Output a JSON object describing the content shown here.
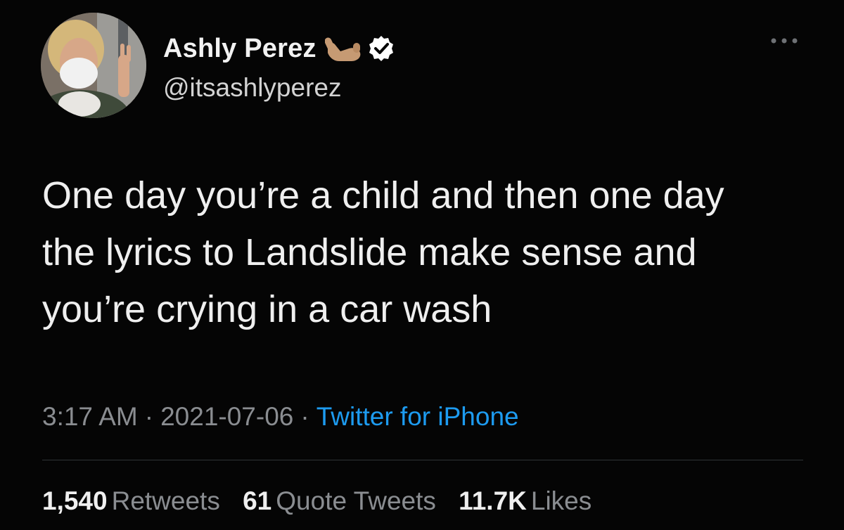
{
  "author": {
    "display_name": "Ashly Perez",
    "handle": "@itsashlyperez",
    "emoji_icon": "call-me-hand-emoji",
    "verified_icon": "verified-badge-icon"
  },
  "more_icon": "more-options-icon",
  "tweet": {
    "text_lines": [
      "One day you’re a child and then one day",
      "the lyrics to Landslide make sense and",
      "you’re crying in a car wash"
    ]
  },
  "meta": {
    "time": "3:17 AM",
    "separator": "·",
    "date": "2021-07-06",
    "source": "Twitter for iPhone"
  },
  "stats": {
    "retweets": {
      "count": "1,540",
      "label": "Retweets"
    },
    "quotes": {
      "count": "61",
      "label": "Quote Tweets"
    },
    "likes": {
      "count": "11.7K",
      "label": "Likes"
    }
  },
  "colors": {
    "background": "#050505",
    "text": "#efefef",
    "muted": "#8a8d91",
    "link": "#1d9bf0"
  }
}
